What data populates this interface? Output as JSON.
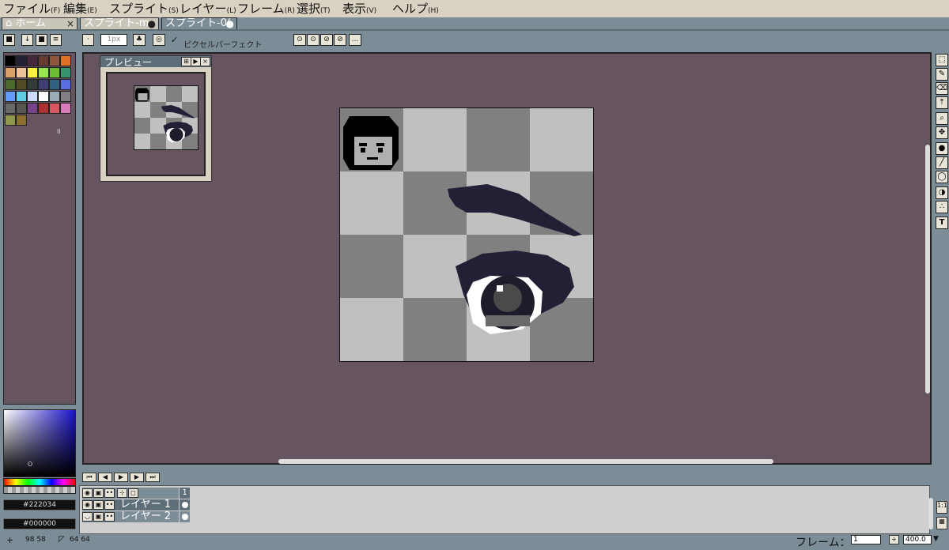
{
  "menu": [
    "ファイル",
    "編集",
    "スプライト",
    "レイヤー",
    "フレーム",
    "選択",
    "表示",
    "ヘルプ"
  ],
  "menu_keys": [
    "(F)",
    "(E)",
    "(S)",
    "(L)",
    "(R)",
    "(T)",
    "(V)",
    "(H)"
  ],
  "tabs": [
    {
      "label": "ホーム",
      "close": "×"
    },
    {
      "label": "スプライト-m",
      "close": "●"
    },
    {
      "label": "スプライト-0(",
      "close": "●"
    }
  ],
  "toolbar": {
    "brush_size": "1px",
    "pixel_perfect_label": "ピクセルパーフェクト",
    "more_label": "..."
  },
  "preview": {
    "title": "プレビュー"
  },
  "colors": {
    "primary_hex": "#222034",
    "secondary_hex": "#000000",
    "palette": [
      "#000000",
      "#222034",
      "#45283c",
      "#663931",
      "#8f563b",
      "#df7126",
      "#d9a066",
      "#eec39a",
      "#fbf236",
      "#99e550",
      "#6abe30",
      "#37946e",
      "#4b692f",
      "#524b24",
      "#323c39",
      "#3f3f74",
      "#306082",
      "#5b6ee1",
      "#639bff",
      "#5fcde4",
      "#cbdbfc",
      "#ffffff",
      "#9badb7",
      "#847e87",
      "#696a6a",
      "#595652",
      "#76428a",
      "#ac3232",
      "#d95763",
      "#d77bba",
      "#8f974a",
      "#8a6f30"
    ]
  },
  "layers": {
    "frame_number": "1",
    "items": [
      {
        "name": "レイヤー 1"
      },
      {
        "name": "レイヤー 2"
      }
    ]
  },
  "status": {
    "cursor_pos": "98 58",
    "sprite_size": "64 64",
    "frame_label": "フレーム：",
    "frame_value": "1",
    "zoom_value": "400.0"
  },
  "sidebar_tools": [
    "marquee-icon",
    "pencil-icon",
    "eraser-icon",
    "eyedropper-icon",
    "zoom-icon",
    "move-icon",
    "fill-icon",
    "line-icon",
    "ellipse-icon",
    "blur-icon",
    "spray-icon",
    "text-icon"
  ]
}
